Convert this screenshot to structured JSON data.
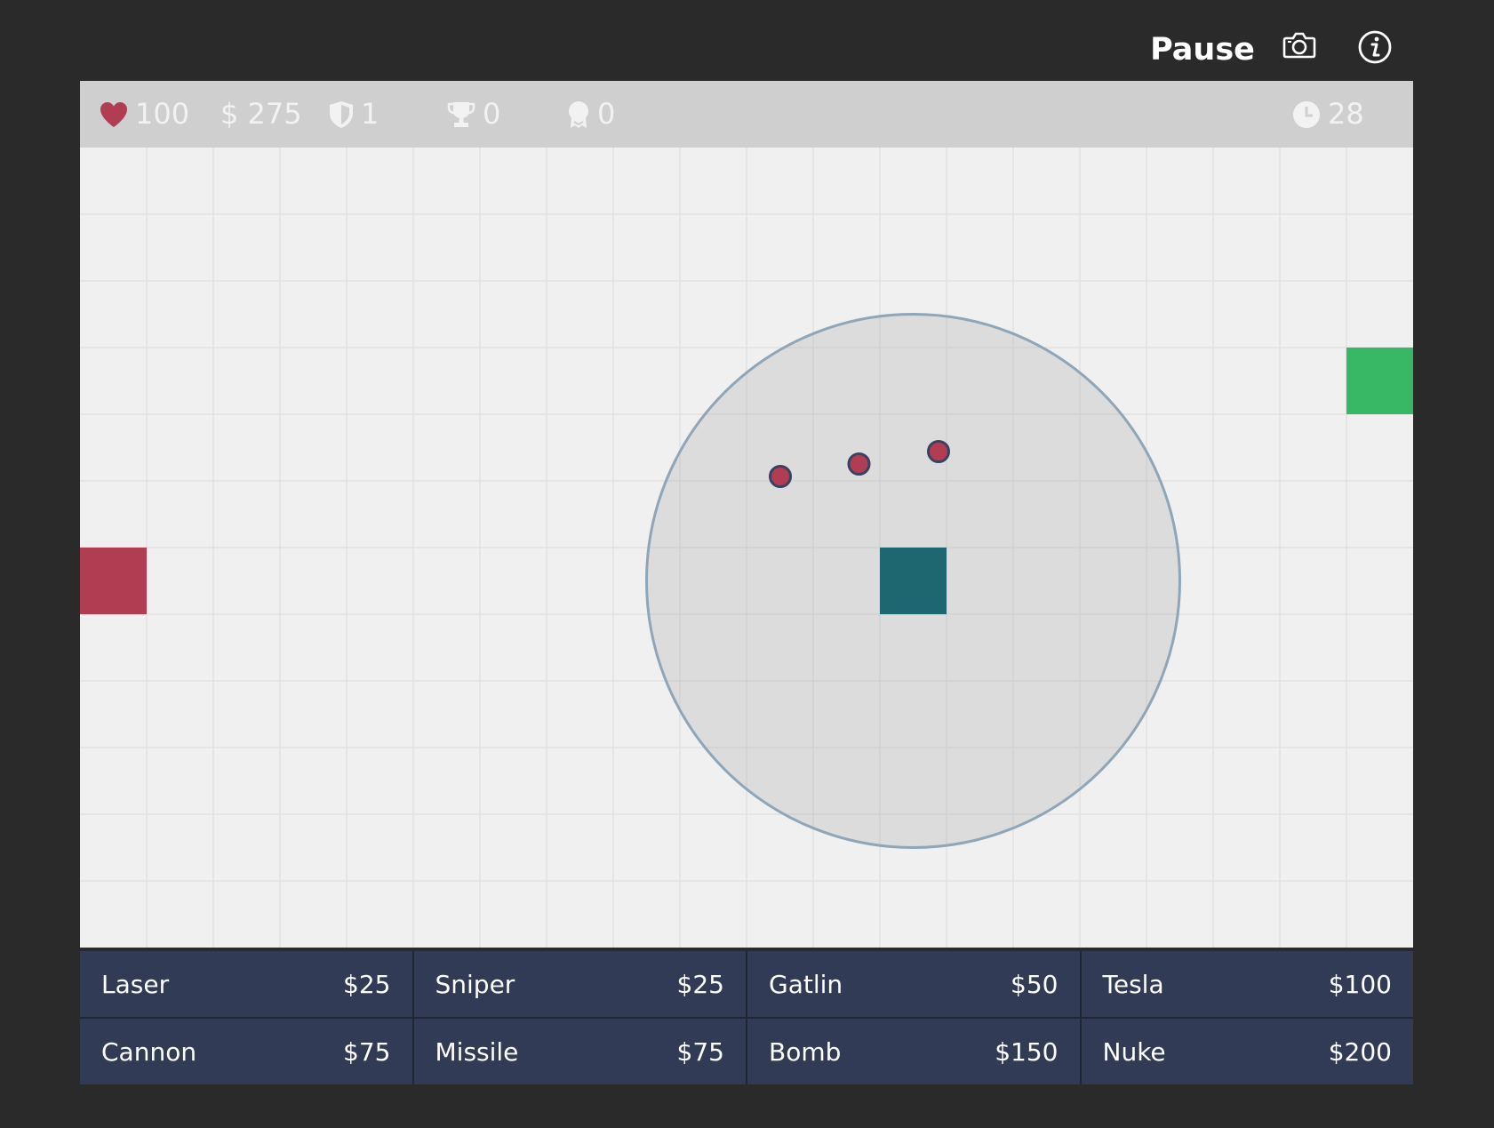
{
  "controls": {
    "pause_label": "Pause",
    "screenshot_icon": "camera-icon",
    "info_icon": "info-icon"
  },
  "stats": {
    "health": "100",
    "money": "$ 275",
    "wave": "1",
    "kills": "0",
    "medals": "0",
    "timer": "28"
  },
  "colors": {
    "health": "#b13d53",
    "spawn": "#b13d53",
    "exit": "#38b764",
    "tower": "#1f6770",
    "range_stroke": "#8fa6b8",
    "enemy": "#b13d53",
    "enemy_outline": "#3b4261",
    "shop_bg": "#323b55"
  },
  "towers": [
    {
      "name": "Laser",
      "price": "$25"
    },
    {
      "name": "Sniper",
      "price": "$25"
    },
    {
      "name": "Gatlin",
      "price": "$50"
    },
    {
      "name": "Tesla",
      "price": "$100"
    },
    {
      "name": "Cannon",
      "price": "$75"
    },
    {
      "name": "Missile",
      "price": "$75"
    },
    {
      "name": "Bomb",
      "price": "$150"
    },
    {
      "name": "Nuke",
      "price": "$200"
    }
  ]
}
